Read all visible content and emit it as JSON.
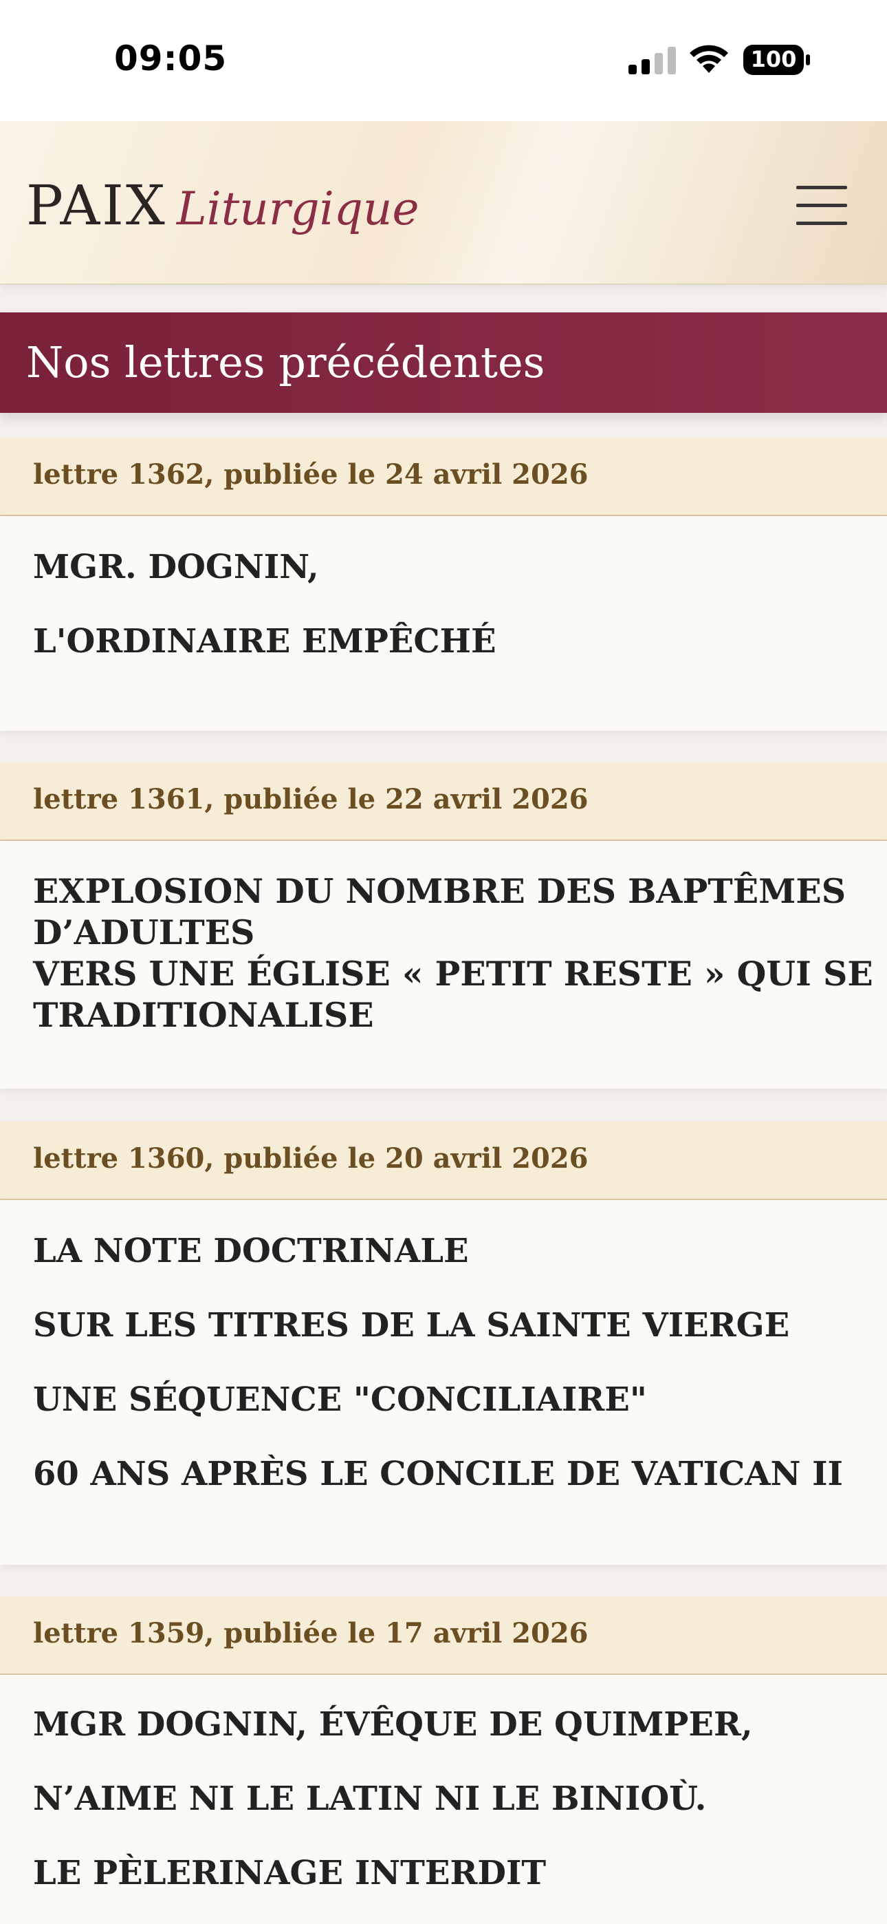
{
  "status_bar": {
    "time": "09:05",
    "signal_icon": "cellular-signal-icon",
    "wifi_icon": "wifi-icon",
    "battery_level": "100",
    "battery_icon": "battery-icon"
  },
  "header": {
    "logo_main": "PAIX",
    "logo_sub": "Liturgique",
    "menu_icon": "hamburger-menu-icon"
  },
  "section": {
    "title": "Nos lettres précédentes"
  },
  "letters": [
    {
      "meta": "lettre 1362, publiée le 24 avril 2026",
      "lines": [
        "MGR. DOGNIN,",
        "L'ORDINAIRE EMPÊCHÉ"
      ]
    },
    {
      "meta": "lettre 1361, publiée le 22 avril 2026",
      "lines": [
        "EXPLOSION DU NOMBRE DES BAPTÊMES",
        "D’ADULTES",
        "VERS UNE ÉGLISE « PETIT RESTE » QUI SE",
        "TRADITIONALISE"
      ]
    },
    {
      "meta": "lettre 1360, publiée le 20 avril 2026",
      "lines": [
        "LA NOTE DOCTRINALE",
        "SUR LES TITRES DE LA SAINTE VIERGE",
        "UNE SÉQUENCE \"CONCILIAIRE\"",
        "60 ANS APRÈS LE CONCILE DE VATICAN II"
      ]
    },
    {
      "meta": "lettre 1359, publiée le 17 avril 2026",
      "lines": [
        "MGR DOGNIN, ÉVÊQUE DE QUIMPER,",
        "N’AIME NI LE LATIN NI LE BINIOÙ.",
        "LE PÈLERINAGE INTERDIT"
      ]
    }
  ]
}
